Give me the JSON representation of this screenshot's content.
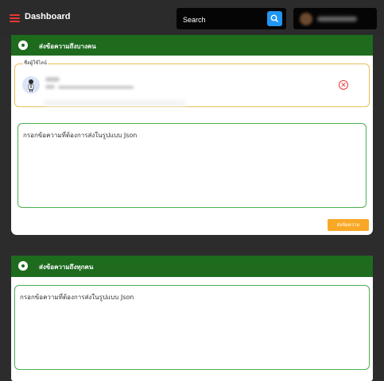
{
  "header": {
    "title": "Dashboard",
    "search_placeholder": "Search"
  },
  "colors": {
    "accent": "#1e6b1e",
    "menu_icon": "#e53935",
    "search_button": "#2196f3",
    "send_button": "#f9a825",
    "users_border": "#e6c05a",
    "textarea_border": "#4caf50"
  },
  "send_some": {
    "header_title": "ส่งข้อความถึงบางคน",
    "users_legend": "ชื่อผู้ใช้ไลน์",
    "textarea_placeholder": "กรอกข้อความที่ต้องการส่งในรูปแบบ Json",
    "send_label": "ส่งข้อความ"
  },
  "send_all": {
    "header_title": "ส่งข้อความถึงทุกคน",
    "textarea_placeholder": "กรอกข้อความที่ต้องการส่งในรูปแบบ Json"
  }
}
